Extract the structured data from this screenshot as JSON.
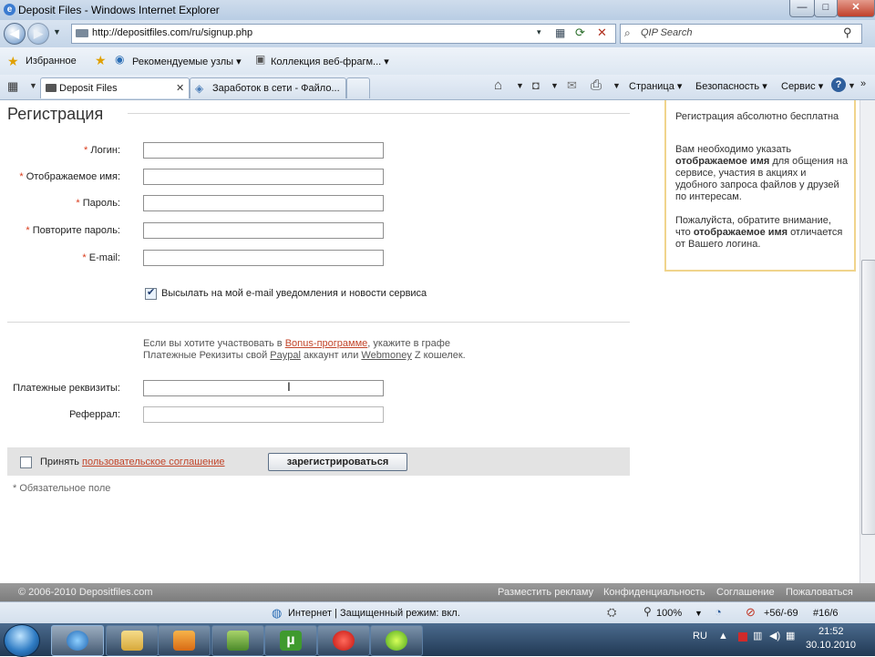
{
  "window": {
    "title": "Deposit Files - Windows Internet Explorer"
  },
  "window_controls": {
    "minimize": "—",
    "maximize": "□",
    "close": "✕"
  },
  "address": {
    "url": "http://depositfiles.com/ru/signup.php"
  },
  "search": {
    "placeholder": "QIP Search"
  },
  "favorites": {
    "label": "Избранное",
    "items": [
      "Рекомендуемые узлы ▾",
      "Коллекция веб-фрагм... ▾"
    ]
  },
  "tabs": [
    {
      "label": "Deposit Files",
      "active": true
    },
    {
      "label": "Заработок в сети - Файло...",
      "active": false
    }
  ],
  "command_bar": {
    "page": "Страница ▾",
    "safety": "Безопасность ▾",
    "tools": "Сервис ▾"
  },
  "form": {
    "title": "Регистрация",
    "required_mark": "*",
    "fields": [
      {
        "label": "Логин:",
        "required": true,
        "value": ""
      },
      {
        "label": "Отображаемое имя:",
        "required": true,
        "value": ""
      },
      {
        "label": "Пароль:",
        "required": true,
        "value": ""
      },
      {
        "label": "Повторите пароль:",
        "required": true,
        "value": ""
      },
      {
        "label": "E-mail:",
        "required": true,
        "value": ""
      }
    ],
    "notify_checkbox": {
      "label": "Высылать на мой e-mail уведомления и новости сервиса",
      "checked": true
    },
    "bonus_text": {
      "line1_a": "Если вы хотите участвовать в ",
      "line1_link": "Bonus-программе",
      "line1_b": ", укажите в графе",
      "line2_a": "Платежные Рекизиты свой ",
      "line2_link1": "Paypal",
      "line2_b": " аккаунт или ",
      "line2_link2": "Webmoney",
      "line2_c": " Z кошелек."
    },
    "payment_label": "Платежные реквизиты:",
    "referral_label": "Реферрал:",
    "accept": {
      "label": "Принять",
      "link": "пользовательское соглашение",
      "checked": false
    },
    "submit_label": "зарегистрироваться",
    "required_note": "* Обязательное поле"
  },
  "info_box": {
    "p1": "Регистрация абсолютно бесплатна",
    "p2_a": "Вам необходимо указать ",
    "p2_b": "отображаемое имя",
    "p2_c": " для общения на сервисе, участия в акциях и удобного запроса файлов у друзей по интересам.",
    "p3_a": "Пожалуйста, обратите внимание, что ",
    "p3_b": "отображаемое имя",
    "p3_c": " отличается от Вашего логина."
  },
  "page_footer": {
    "copyright": "© 2006-2010 Depositfiles.com",
    "links": [
      "Разместить рекламу",
      "Конфиденциальность",
      "Соглашение",
      "Пожаловаться"
    ]
  },
  "status": {
    "zone": "Интернет | Защищенный режим: вкл.",
    "zoom": "100%",
    "counter": "+56/-69",
    "tab_counter": "#16/6"
  },
  "taskbar": {
    "lang": "RU",
    "time": "21:52",
    "date": "30.10.2010"
  }
}
